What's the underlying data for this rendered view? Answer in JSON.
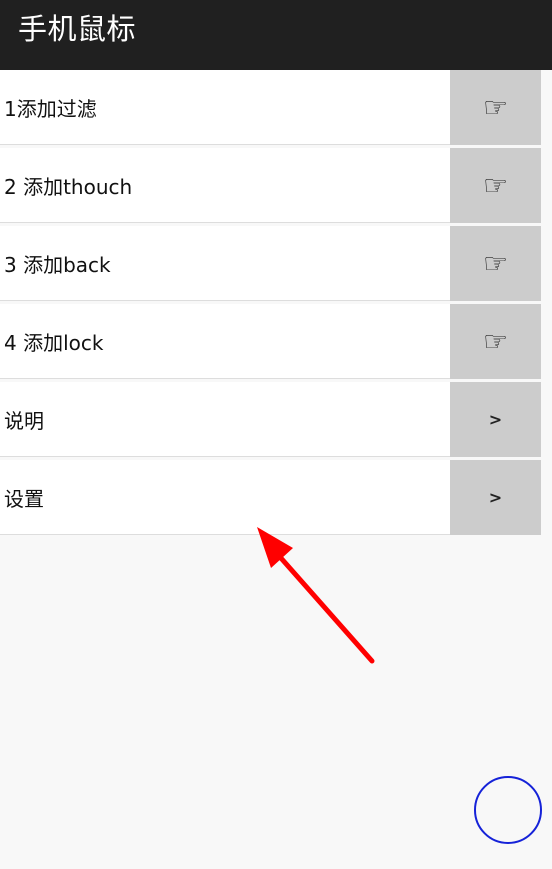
{
  "header": {
    "title": "手机鼠标"
  },
  "menu": [
    {
      "label": "1添加过滤",
      "action": "☞",
      "action_icon": "pointing-hand-icon"
    },
    {
      "label": "2 添加thouch",
      "action": "☞",
      "action_icon": "pointing-hand-icon"
    },
    {
      "label": "3 添加back",
      "action": "☞",
      "action_icon": "pointing-hand-icon"
    },
    {
      "label": "4 添加lock",
      "action": "☞",
      "action_icon": "pointing-hand-icon"
    },
    {
      "label": "说明",
      "action": ">",
      "action_icon": "chevron-right-icon"
    },
    {
      "label": "设置",
      "action": ">",
      "action_icon": "chevron-right-icon"
    }
  ],
  "colors": {
    "app_bar": "#202020",
    "list_background": "#ffffff",
    "action_background": "#cccccc",
    "arrow": "#ff0000",
    "floating_circle": "#1522d8"
  },
  "icons": {
    "annotation": "red-arrow-icon",
    "floating_control": "blue-circle-icon"
  }
}
